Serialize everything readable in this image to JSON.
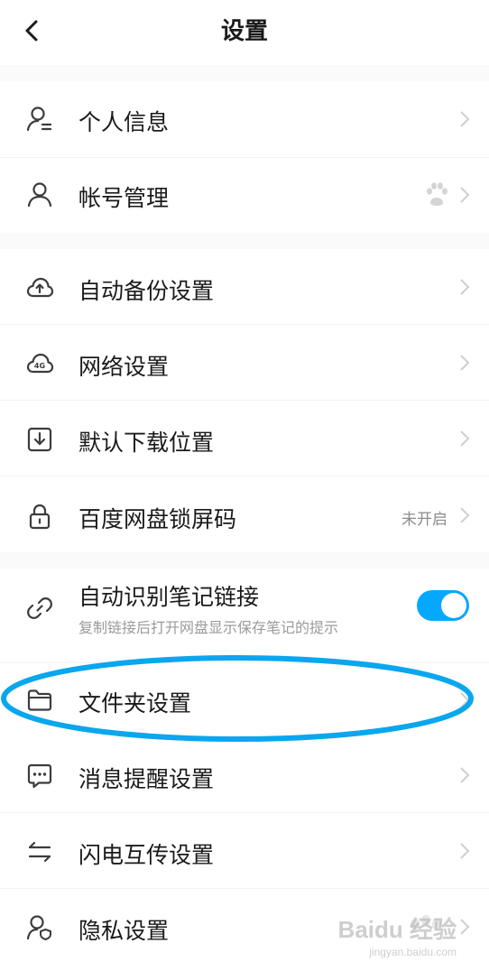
{
  "header": {
    "title": "设置"
  },
  "rows": {
    "personal_info": {
      "label": "个人信息"
    },
    "account": {
      "label": "帐号管理"
    },
    "auto_backup": {
      "label": "自动备份设置"
    },
    "network": {
      "label": "网络设置"
    },
    "download_location": {
      "label": "默认下载位置"
    },
    "lock_screen": {
      "label": "百度网盘锁屏码",
      "value": "未开启"
    },
    "note_links": {
      "label": "自动识别笔记链接",
      "sub": "复制链接后打开网盘显示保存笔记的提示",
      "toggle": "on"
    },
    "folder": {
      "label": "文件夹设置"
    },
    "messages": {
      "label": "消息提醒设置"
    },
    "flash_transfer": {
      "label": "闪电互传设置"
    },
    "privacy": {
      "label": "隐私设置"
    }
  },
  "watermark": {
    "text": "Baidu 经验",
    "sub": "jingyan.baidu.com"
  },
  "colors": {
    "accent": "#06a7ff",
    "annotation": "#0aa6ee",
    "icon": "#3c3c3c",
    "chevron": "#cfcfcf"
  }
}
